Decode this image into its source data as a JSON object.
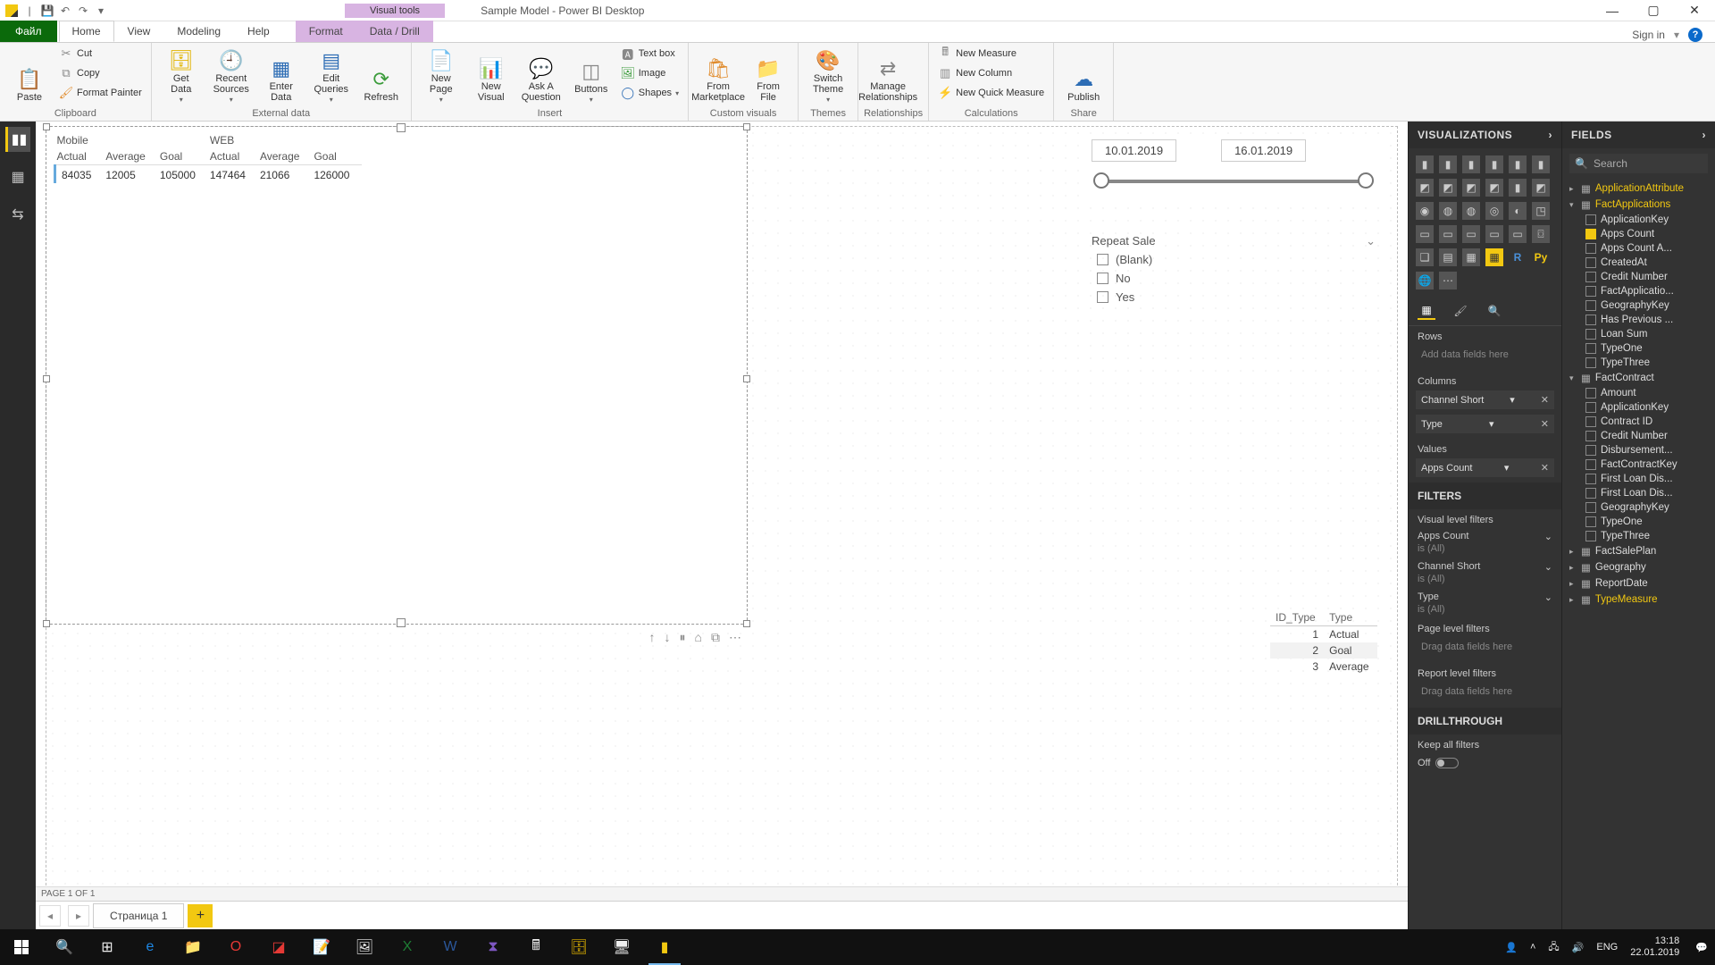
{
  "window": {
    "title": "Sample Model - Power BI Desktop",
    "visual_tools": "Visual tools"
  },
  "qat": {
    "save": "💾",
    "undo": "↶",
    "redo": "↷"
  },
  "winbuttons": {
    "min": "—",
    "max": "▢",
    "close": "✕"
  },
  "menu": {
    "file": "Файл",
    "home": "Home",
    "view": "View",
    "modeling": "Modeling",
    "help": "Help",
    "format": "Format",
    "datadrill": "Data / Drill",
    "signin": "Sign in"
  },
  "ribbon": {
    "clipboard": {
      "label": "Clipboard",
      "paste": "Paste",
      "cut": "Cut",
      "copy": "Copy",
      "painter": "Format Painter"
    },
    "externaldata": {
      "label": "External data",
      "get": "Get\nData",
      "recent": "Recent\nSources",
      "enter": "Enter\nData",
      "edit": "Edit\nQueries",
      "refresh": "Refresh"
    },
    "insert": {
      "label": "Insert",
      "newpage": "New\nPage",
      "newvisual": "New\nVisual",
      "askq": "Ask A\nQuestion",
      "buttons": "Buttons",
      "textbox": "Text box",
      "image": "Image",
      "shapes": "Shapes"
    },
    "customvisuals": {
      "label": "Custom visuals",
      "market": "From\nMarketplace",
      "file": "From\nFile"
    },
    "themes": {
      "label": "Themes",
      "switch": "Switch\nTheme"
    },
    "relationships": {
      "label": "Relationships",
      "manage": "Manage\nRelationships"
    },
    "calculations": {
      "label": "Calculations",
      "measure": "New Measure",
      "column": "New Column",
      "quick": "New Quick Measure"
    },
    "share": {
      "label": "Share",
      "publish": "Publish"
    }
  },
  "canvas": {
    "matrix": {
      "groups": [
        "Mobile",
        "WEB"
      ],
      "cols": [
        "Actual",
        "Average",
        "Goal",
        "Actual",
        "Average",
        "Goal"
      ],
      "rows": [
        [
          "84035",
          "12005",
          "105000",
          "147464",
          "21066",
          "126000"
        ]
      ]
    },
    "dateslicer": {
      "from": "10.01.2019",
      "to": "16.01.2019"
    },
    "repeat": {
      "title": "Repeat Sale",
      "options": [
        "(Blank)",
        "No",
        "Yes"
      ]
    },
    "small": {
      "headers": [
        "ID_Type",
        "Type"
      ],
      "rows": [
        [
          "1",
          "Actual"
        ],
        [
          "2",
          "Goal"
        ],
        [
          "3",
          "Average"
        ]
      ]
    },
    "viz_toolbar": [
      "↑",
      "↓",
      "⏸",
      "⌂",
      "⧉",
      "⋯"
    ]
  },
  "pagetabs": {
    "page1": "Страница 1",
    "add": "+"
  },
  "page_indicator": "PAGE 1 OF 1",
  "viz_pane": {
    "title": "VISUALIZATIONS",
    "wells": {
      "rows_label": "Rows",
      "rows_empty": "Add data fields here",
      "cols_label": "Columns",
      "cols": [
        "Channel Short",
        "Type"
      ],
      "vals_label": "Values",
      "vals": [
        "Apps Count"
      ]
    },
    "filters_title": "FILTERS",
    "filters": {
      "visual_label": "Visual level filters",
      "items": [
        {
          "name": "Apps Count",
          "val": "is (All)"
        },
        {
          "name": "Channel Short",
          "val": "is (All)"
        },
        {
          "name": "Type",
          "val": "is (All)"
        }
      ],
      "page_label": "Page level filters",
      "page_empty": "Drag data fields here",
      "report_label": "Report level filters",
      "report_empty": "Drag data fields here"
    },
    "drill_title": "DRILLTHROUGH",
    "drill_keep": "Keep all filters",
    "drill_off": "Off"
  },
  "fields_pane": {
    "title": "FIELDS",
    "search": "Search",
    "tables": [
      {
        "name": "ApplicationAttribute",
        "open": false,
        "hi": true
      },
      {
        "name": "FactApplications",
        "open": true,
        "hi": true,
        "cols": [
          {
            "name": "ApplicationKey"
          },
          {
            "name": "Apps Count",
            "checked": true
          },
          {
            "name": "Apps Count A..."
          },
          {
            "name": "CreatedAt"
          },
          {
            "name": "Credit Number"
          },
          {
            "name": "FactApplicatio..."
          },
          {
            "name": "GeographyKey"
          },
          {
            "name": "Has Previous ..."
          },
          {
            "name": "Loan Sum"
          },
          {
            "name": "TypeOne"
          },
          {
            "name": "TypeThree"
          }
        ]
      },
      {
        "name": "FactContract",
        "open": true,
        "cols": [
          {
            "name": "Amount"
          },
          {
            "name": "ApplicationKey"
          },
          {
            "name": "Contract ID"
          },
          {
            "name": "Credit Number"
          },
          {
            "name": "Disbursement..."
          },
          {
            "name": "FactContractKey"
          },
          {
            "name": "First Loan Dis..."
          },
          {
            "name": "First Loan Dis..."
          },
          {
            "name": "GeographyKey"
          },
          {
            "name": "TypeOne"
          },
          {
            "name": "TypeThree"
          }
        ]
      },
      {
        "name": "FactSalePlan",
        "open": false
      },
      {
        "name": "Geography",
        "open": false
      },
      {
        "name": "ReportDate",
        "open": false
      },
      {
        "name": "TypeMeasure",
        "open": false,
        "hi": true
      }
    ]
  },
  "taskbar": {
    "tray": {
      "lang": "ENG",
      "time": "13:18",
      "date": "22.01.2019"
    }
  }
}
